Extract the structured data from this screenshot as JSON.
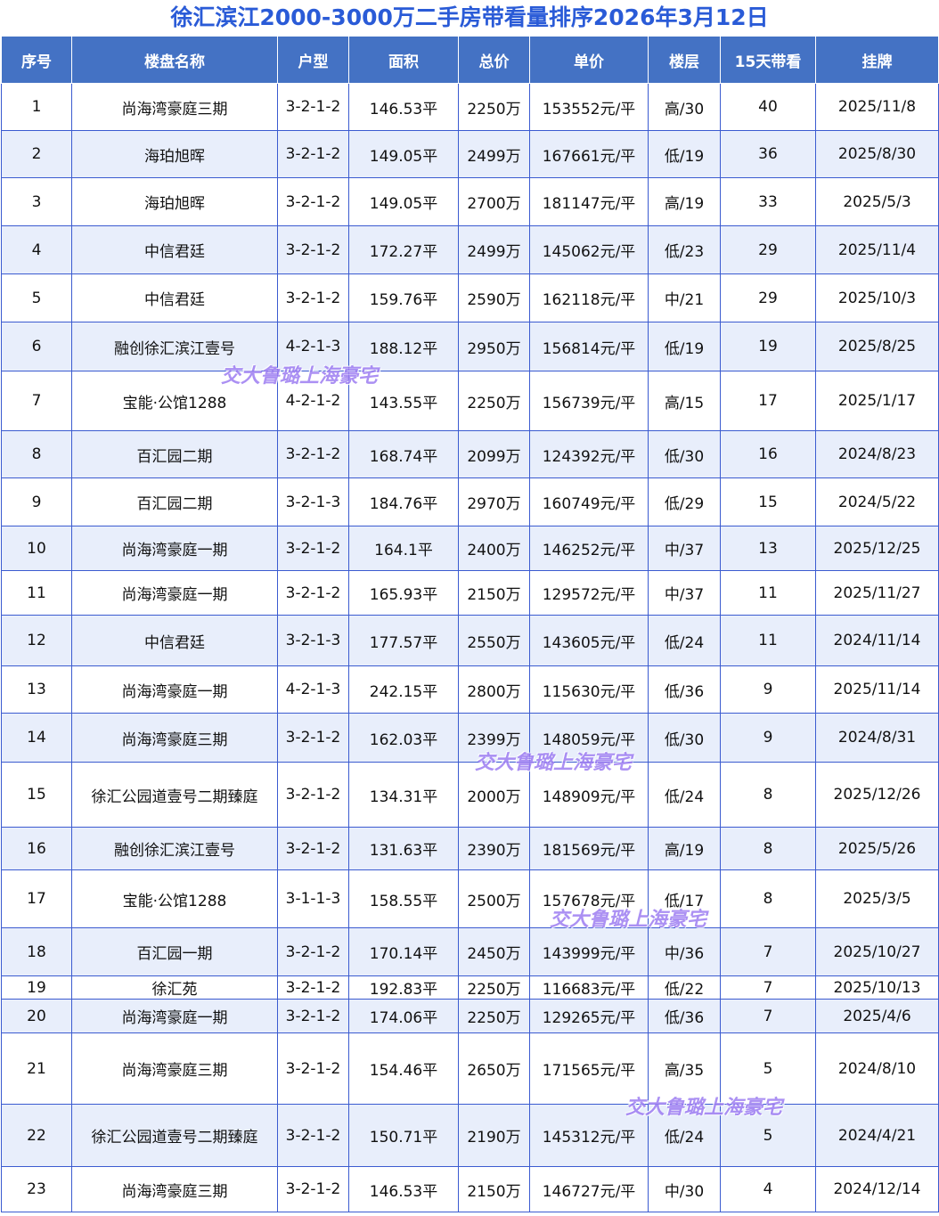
{
  "title": "徐汇滨江2000-3000万二手房带看量排序2026年3月12日",
  "headers": [
    "序号",
    "楼盘名称",
    "户型",
    "面积",
    "总价",
    "单价",
    "楼层",
    "15天带看",
    "挂牌"
  ],
  "rows": [
    [
      "1",
      "尚海湾豪庭三期",
      "3-2-1-2",
      "146.53平",
      "2250万",
      "153552元/平",
      "高/30",
      "40",
      "2025/11/8"
    ],
    [
      "2",
      "海珀旭晖",
      "3-2-1-2",
      "149.05平",
      "2499万",
      "167661元/平",
      "低/19",
      "36",
      "2025/8/30"
    ],
    [
      "3",
      "海珀旭晖",
      "3-2-1-2",
      "149.05平",
      "2700万",
      "181147元/平",
      "高/19",
      "33",
      "2025/5/3"
    ],
    [
      "4",
      "中信君廷",
      "3-2-1-2",
      "172.27平",
      "2499万",
      "145062元/平",
      "低/23",
      "29",
      "2025/11/4"
    ],
    [
      "5",
      "中信君廷",
      "3-2-1-2",
      "159.76平",
      "2590万",
      "162118元/平",
      "中/21",
      "29",
      "2025/10/3"
    ],
    [
      "6",
      "融创徐汇滨江壹号",
      "4-2-1-3",
      "188.12平",
      "2950万",
      "156814元/平",
      "低/19",
      "19",
      "2025/8/25"
    ],
    [
      "7",
      "宝能·公馆1288",
      "4-2-1-2",
      "143.55平",
      "2250万",
      "156739元/平",
      "高/15",
      "17",
      "2025/1/17"
    ],
    [
      "8",
      "百汇园二期",
      "3-2-1-2",
      "168.74平",
      "2099万",
      "124392元/平",
      "低/30",
      "16",
      "2024/8/23"
    ],
    [
      "9",
      "百汇园二期",
      "3-2-1-3",
      "184.76平",
      "2970万",
      "160749元/平",
      "低/29",
      "15",
      "2024/5/22"
    ],
    [
      "10",
      "尚海湾豪庭一期",
      "3-2-1-2",
      "164.1平",
      "2400万",
      "146252元/平",
      "中/37",
      "13",
      "2025/12/25"
    ],
    [
      "11",
      "尚海湾豪庭一期",
      "3-2-1-2",
      "165.93平",
      "2150万",
      "129572元/平",
      "中/37",
      "11",
      "2025/11/27"
    ],
    [
      "12",
      "中信君廷",
      "3-2-1-3",
      "177.57平",
      "2550万",
      "143605元/平",
      "低/24",
      "11",
      "2024/11/14"
    ],
    [
      "13",
      "尚海湾豪庭一期",
      "4-2-1-3",
      "242.15平",
      "2800万",
      "115630元/平",
      "低/36",
      "9",
      "2025/11/14"
    ],
    [
      "14",
      "尚海湾豪庭三期",
      "3-2-1-2",
      "162.03平",
      "2399万",
      "148059元/平",
      "低/30",
      "9",
      "2024/8/31"
    ],
    [
      "15",
      "徐汇公园道壹号二期臻庭",
      "3-2-1-2",
      "134.31平",
      "2000万",
      "148909元/平",
      "低/24",
      "8",
      "2025/12/26"
    ],
    [
      "16",
      "融创徐汇滨江壹号",
      "3-2-1-2",
      "131.63平",
      "2390万",
      "181569元/平",
      "高/19",
      "8",
      "2025/5/26"
    ],
    [
      "17",
      "宝能·公馆1288",
      "3-1-1-3",
      "158.55平",
      "2500万",
      "157678元/平",
      "低/17",
      "8",
      "2025/3/5"
    ],
    [
      "18",
      "百汇园一期",
      "3-2-1-2",
      "170.14平",
      "2450万",
      "143999元/平",
      "中/36",
      "7",
      "2025/10/27"
    ],
    [
      "19",
      "徐汇苑",
      "3-2-1-2",
      "192.83平",
      "2250万",
      "116683元/平",
      "低/22",
      "7",
      "2025/10/13"
    ],
    [
      "20",
      "尚海湾豪庭一期",
      "3-2-1-2",
      "174.06平",
      "2250万",
      "129265元/平",
      "低/36",
      "7",
      "2025/4/6"
    ],
    [
      "21",
      "尚海湾豪庭三期",
      "3-2-1-2",
      "154.46平",
      "2650万",
      "171565元/平",
      "高/35",
      "5",
      "2024/8/10"
    ],
    [
      "22",
      "徐汇公园道壹号二期臻庭",
      "3-2-1-2",
      "150.71平",
      "2190万",
      "145312元/平",
      "低/24",
      "5",
      "2024/4/21"
    ],
    [
      "23",
      "尚海湾豪庭三期",
      "3-2-1-2",
      "146.53平",
      "2150万",
      "146727元/平",
      "中/30",
      "4",
      "2024/12/14"
    ]
  ],
  "watermark": "交大鲁璐上海豪宅",
  "colors": {
    "title": "#2a5bd7",
    "header_bg": "#4472c4",
    "stripe": "#e8eefb",
    "border": "#3b5bd0",
    "watermark": "#9d7df2"
  }
}
